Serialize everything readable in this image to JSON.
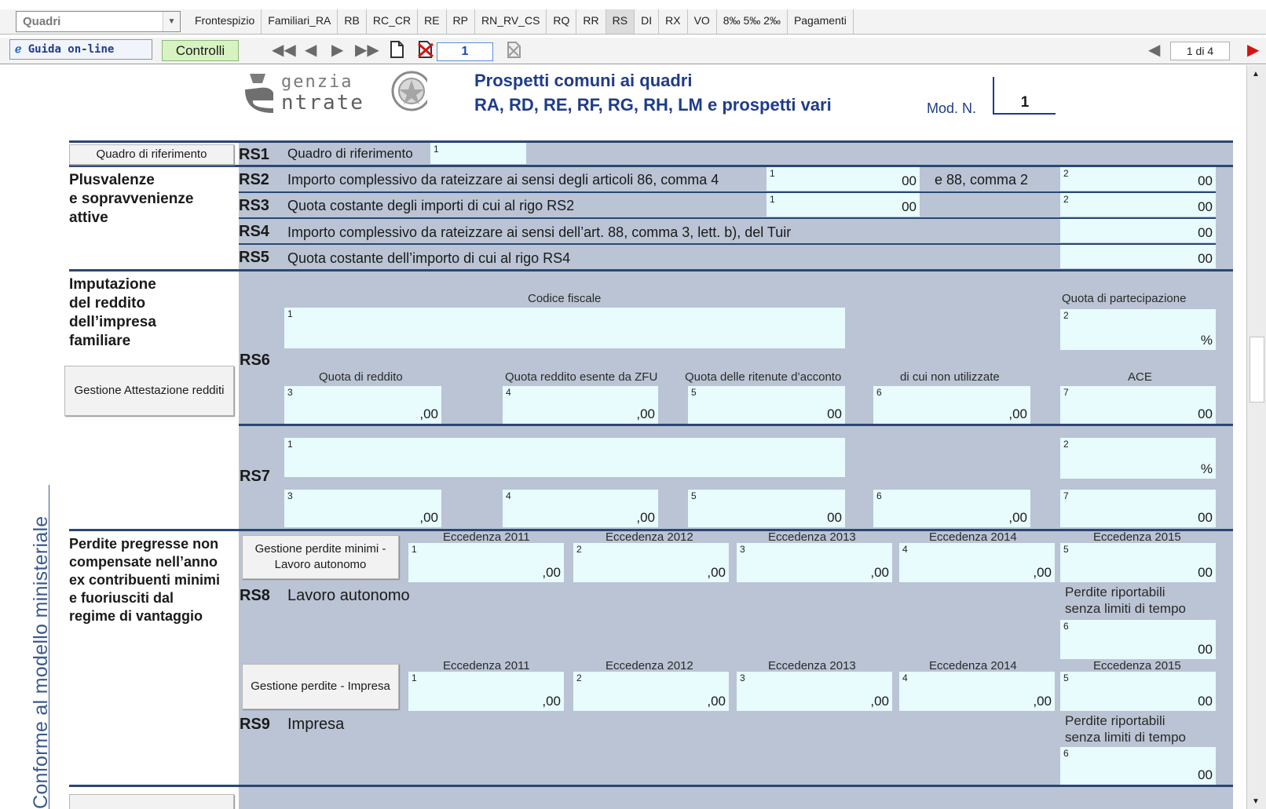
{
  "top_bar": {
    "quadri_select": {
      "value": "Quadri"
    },
    "tabs": [
      "Frontespizio",
      "Familiari_RA",
      "RB",
      "RC_CR",
      "RE",
      "RP",
      "RN_RV_CS",
      "RQ",
      "RR",
      "RS",
      "DI",
      "RX",
      "VO",
      "8‰ 5‰ 2‰",
      "Pagamenti"
    ],
    "active_tab": "RS"
  },
  "toolbar": {
    "help_label": "Guida on-line",
    "help_icon": "ie-icon",
    "controls_label": "Controlli",
    "module_page_value": "1",
    "page_indicator": "1 di 4"
  },
  "sidebar": {
    "label": "Conforme al modello ministeriale"
  },
  "header": {
    "logo_text_1": "genzia",
    "logo_text_2": "ntrate",
    "title_line1": "Prospetti comuni ai quadri",
    "title_line2": "RA, RD, RE, RF, RG, RH, LM e prospetti vari",
    "mod_label": "Mod. N.",
    "mod_value": "1"
  },
  "colors": {
    "panel": "#bac4d4",
    "field": "#e8fbfd",
    "rule": "#2a4774",
    "title": "#1f3c8a",
    "controls_bg": "#d7f3c2"
  },
  "sections": {
    "rs1": {
      "button": "Quadro di riferimento",
      "code": "RS1",
      "label": "Quadro di riferimento",
      "field_num": "1"
    },
    "plusvalenze": {
      "title_lines": [
        "Plusvalenze",
        "e sopravvenienze",
        "attive"
      ],
      "rows": [
        {
          "code": "RS2",
          "label": "Importo complessivo da rateizzare ai sensi degli articoli 86, comma 4",
          "mid_label": "e 88, comma 2",
          "f1_num": "1",
          "f1_cents": "00",
          "f2_num": "2",
          "f2_cents": "00"
        },
        {
          "code": "RS3",
          "label": "Quota costante degli importi di cui al rigo RS2",
          "f1_num": "1",
          "f1_cents": "00",
          "f2_num": "2",
          "f2_cents": "00"
        },
        {
          "code": "RS4",
          "label": "Importo complessivo da rateizzare ai sensi dell’art. 88, comma 3, lett. b), del Tuir",
          "f2_cents": "00"
        },
        {
          "code": "RS5",
          "label": "Quota costante dell’importo di cui al rigo RS4",
          "f2_cents": "00"
        }
      ]
    },
    "imputazione": {
      "title_lines": [
        "Imputazione",
        "del reddito",
        "dell’impresa",
        "familiare"
      ],
      "button": "Gestione Attestazione redditi",
      "headers": {
        "codice_fiscale": "Codice fiscale",
        "quota_partecipazione": "Quota di partecipazione",
        "quota_reddito": "Quota di reddito",
        "quota_zfu": "Quota reddito esente da ZFU",
        "quota_ritenute": "Quota delle ritenute d’acconto",
        "non_utilizzate": "di cui non utilizzate",
        "ace": "ACE"
      },
      "rows": [
        {
          "code": "RS6",
          "pct": "%",
          "f1": "1",
          "f2": "2",
          "f3": "3",
          "f4": "4",
          "f5": "5",
          "f6": "6",
          "f7": "7",
          "c3": ",00",
          "c4": ",00",
          "c5": "00",
          "c6": ",00",
          "c7": "00"
        },
        {
          "code": "RS7",
          "pct": "%",
          "f1": "1",
          "f2": "2",
          "f3": "3",
          "f4": "4",
          "f5": "5",
          "f6": "6",
          "f7": "7",
          "c3": ",00",
          "c4": ",00",
          "c5": "00",
          "c6": ",00",
          "c7": "00"
        }
      ]
    },
    "perdite": {
      "title_lines": [
        "Perdite pregresse non",
        "compensate nell’anno",
        "ex contribuenti minimi",
        "e fuoriusciti dal",
        "regime di vantaggio"
      ],
      "years": [
        "Eccedenza 2011",
        "Eccedenza 2012",
        "Eccedenza 2013",
        "Eccedenza 2014",
        "Eccedenza 2015"
      ],
      "riportabili_lines": [
        "Perdite riportabili",
        "senza limiti di tempo"
      ],
      "rows": [
        {
          "code": "RS8",
          "label": "Lavoro autonomo",
          "button": "Gestione perdite minimi - Lavoro autonomo",
          "f1": "1",
          "f2": "2",
          "f3": "3",
          "f4": "4",
          "f5": "5",
          "f6": "6",
          "c1": ",00",
          "c2": ",00",
          "c3": ",00",
          "c4": ",00",
          "c5": "00",
          "c6": "00"
        },
        {
          "code": "RS9",
          "label": "Impresa",
          "button": "Gestione perdite - Impresa",
          "f1": "1",
          "f2": "2",
          "f3": "3",
          "f4": "4",
          "f5": "5",
          "f6": "6",
          "c1": ",00",
          "c2": ",00",
          "c3": ",00",
          "c4": ",00",
          "c5": "00",
          "c6": "00"
        }
      ]
    }
  }
}
